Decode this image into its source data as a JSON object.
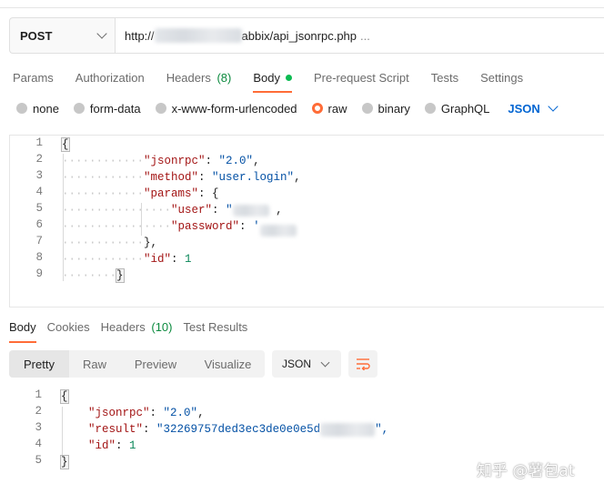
{
  "request": {
    "method": "POST",
    "url_prefix": "http://",
    "url_suffix": "abbix/api_jsonrpc.php",
    "url_ellipsis": "..."
  },
  "request_tabs": [
    {
      "label": "Params"
    },
    {
      "label": "Authorization"
    },
    {
      "label": "Headers",
      "count": "(8)"
    },
    {
      "label": "Body",
      "active": true
    },
    {
      "label": "Pre-request Script"
    },
    {
      "label": "Tests"
    },
    {
      "label": "Settings"
    }
  ],
  "body_types": [
    {
      "label": "none"
    },
    {
      "label": "form-data"
    },
    {
      "label": "x-www-form-urlencoded"
    },
    {
      "label": "raw",
      "selected": true
    },
    {
      "label": "binary"
    },
    {
      "label": "GraphQL"
    }
  ],
  "body_language": "JSON",
  "request_body": {
    "line_numbers": [
      "1",
      "2",
      "3",
      "4",
      "5",
      "6",
      "7",
      "8",
      "9"
    ],
    "open_brace": "{",
    "jsonrpc_key": "\"jsonrpc\"",
    "jsonrpc_val": "\"2.0\"",
    "method_key": "\"method\"",
    "method_val": "\"user.login\"",
    "params_key": "\"params\"",
    "user_key": "\"user\"",
    "user_val_open": "\"",
    "password_key": "\"password\"",
    "password_val_open": "'",
    "close_params": "},",
    "id_key": "\"id\"",
    "id_val": "1",
    "close_brace": "}"
  },
  "response_tabs": [
    {
      "label": "Body",
      "active": true
    },
    {
      "label": "Cookies"
    },
    {
      "label": "Headers",
      "count": "(10)"
    },
    {
      "label": "Test Results"
    }
  ],
  "view_modes": [
    "Pretty",
    "Raw",
    "Preview",
    "Visualize"
  ],
  "response_format": "JSON",
  "response_body": {
    "line_numbers": [
      "1",
      "2",
      "3",
      "4",
      "5"
    ],
    "open_brace": "{",
    "jsonrpc_key": "\"jsonrpc\"",
    "jsonrpc_val": "\"2.0\"",
    "result_key": "\"result\"",
    "result_val": "\"32269757ded3ec3de0e0e5d",
    "result_val_end": "\",",
    "id_key": "\"id\"",
    "id_val": "1",
    "close_brace": "}"
  },
  "watermark": "知乎 @薯包at",
  "colors": {
    "accent": "#ff6c37",
    "link_blue": "#0265d2",
    "count_green": "#0b8a3e",
    "dot_green": "#0cbb52"
  }
}
